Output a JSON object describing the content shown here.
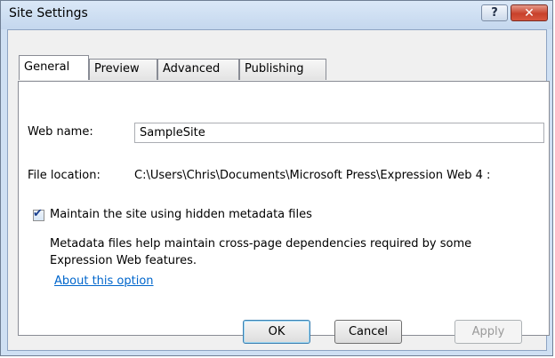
{
  "window": {
    "title": "Site Settings",
    "help_icon": "?",
    "close_icon": "✕"
  },
  "tabs": [
    {
      "label": "General",
      "active": true
    },
    {
      "label": "Preview",
      "active": false
    },
    {
      "label": "Advanced",
      "active": false
    },
    {
      "label": "Publishing",
      "active": false
    }
  ],
  "general": {
    "web_name_label": "Web name:",
    "web_name_value": "SampleSite",
    "file_location_label": "File location:",
    "file_location_value": "C:\\Users\\Chris\\Documents\\Microsoft Press\\Expression Web 4 :",
    "metadata_checkbox_label": "Maintain the site using hidden metadata files",
    "metadata_checked": true,
    "description_line1": "Metadata files help maintain cross-page dependencies required by some",
    "description_line2": "Expression Web features.",
    "about_link": "About this option"
  },
  "buttons": {
    "ok": "OK",
    "cancel": "Cancel",
    "apply": "Apply"
  }
}
